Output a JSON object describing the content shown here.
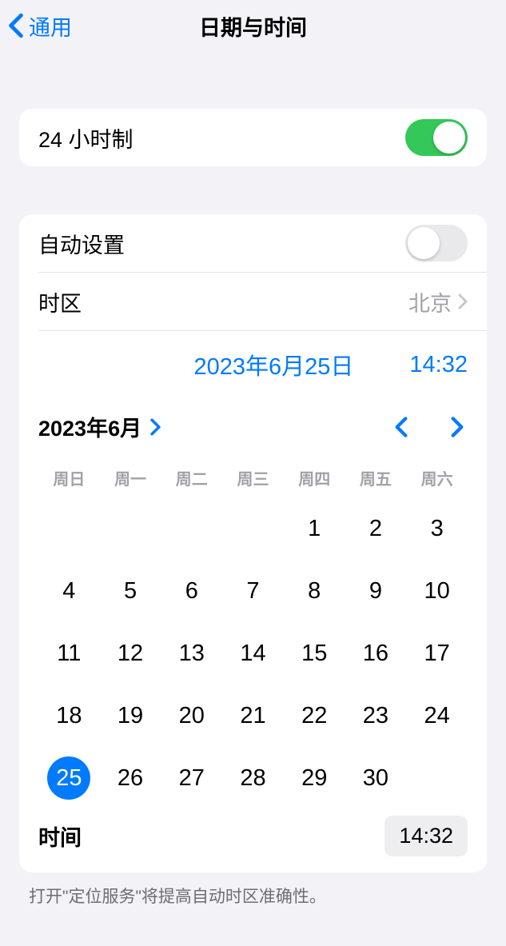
{
  "nav": {
    "back_label": "通用",
    "title": "日期与时间"
  },
  "settings": {
    "twentyfour_label": "24 小时制",
    "twentyfour_on": true,
    "autoset_label": "自动设置",
    "autoset_on": false,
    "timezone_label": "时区",
    "timezone_value": "北京"
  },
  "selected": {
    "date_display": "2023年6月25日",
    "time_display": "14:32"
  },
  "calendar": {
    "month_label": "2023年6月",
    "weekdays": [
      "周日",
      "周一",
      "周二",
      "周三",
      "周四",
      "周五",
      "周六"
    ],
    "leading_blanks": 4,
    "days_in_month": 30,
    "selected_day": 25,
    "time_label": "时间",
    "time_value": "14:32"
  },
  "footer": {
    "note": "打开\"定位服务\"将提高自动时区准确性。"
  }
}
